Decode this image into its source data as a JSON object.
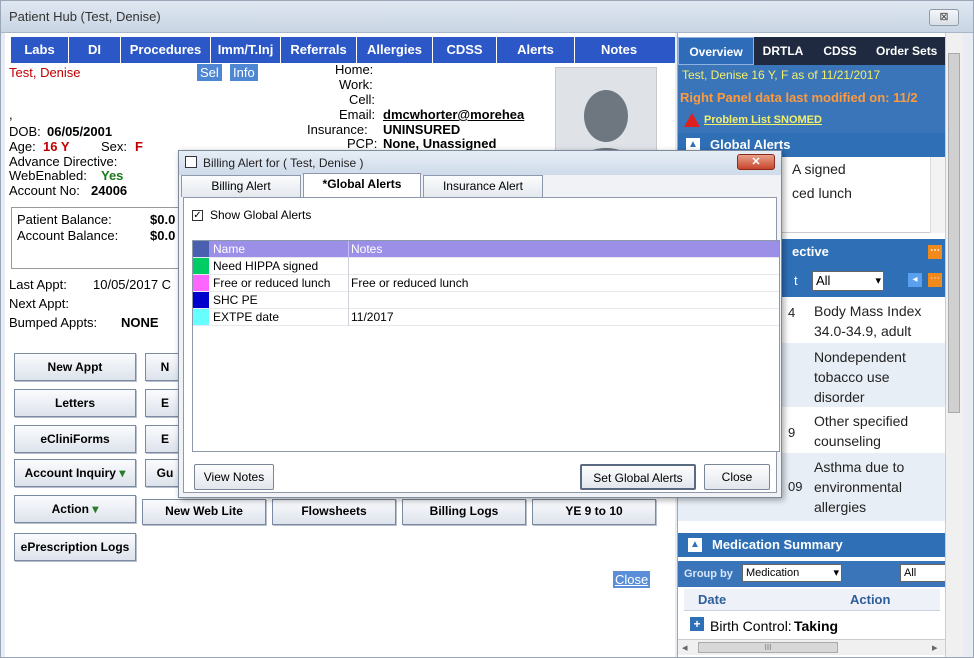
{
  "window": {
    "title": "Patient Hub (Test, Denise)",
    "close_glyph": "⊠"
  },
  "nav": {
    "tabs": [
      "Labs",
      "DI",
      "Procedures",
      "Imm/T.Inj",
      "Referrals",
      "Allergies",
      "CDSS",
      "Alerts",
      "Notes"
    ]
  },
  "patient": {
    "name": "Test, Denise",
    "sel_label": "Sel",
    "info_label": "Info",
    "stray": ", ",
    "dob_label": "DOB:",
    "dob": "06/05/2001",
    "age_label": "Age:",
    "age": "16 Y",
    "sex_label": "Sex:",
    "sex": "F",
    "advance_directive_label": "Advance Directive:",
    "webenabled_label": "WebEnabled:",
    "webenabled": "Yes",
    "account_no_label": "Account No:",
    "account_no": "24006",
    "home_label": "Home:",
    "work_label": "Work:",
    "cell_label": "Cell:",
    "email_label": "Email:",
    "email": "dmcwhorter@morehea",
    "insurance_label": "Insurance:",
    "insurance": "UNINSURED",
    "pcp_label": "PCP:",
    "pcp": "None, Unassigned",
    "patient_balance_label": "Patient Balance:",
    "patient_balance": "$0.0",
    "account_balance_label": "Account Balance:",
    "account_balance": "$0.0",
    "last_appt_label": "Last Appt:",
    "last_appt": "10/05/2017 C",
    "next_appt_label": "Next Appt:",
    "bumped_label": "Bumped Appts:",
    "bumped": "NONE"
  },
  "actions": {
    "new_appt": "New Appt",
    "letters": "Letters",
    "ecliniforms": "eCliniForms",
    "account_inquiry": "Account Inquiry",
    "action": "Action",
    "eprescription_logs": "ePrescription Logs",
    "dropdown_glyph": "▾",
    "partial_n": "N",
    "partial_e1": "E",
    "partial_e2": "E",
    "partial_gu": "Gu",
    "new_web_lite": "New Web Lite",
    "flowsheets": "Flowsheets",
    "billing_logs": "Billing Logs",
    "ye_to_10": "YE 9 to 10",
    "close": "Close"
  },
  "right_panel": {
    "tabs": [
      "Overview",
      "DRTLA",
      "CDSS",
      "Order Sets"
    ],
    "patient_line": "Test, Denise 16 Y, F as of 11/21/2017",
    "modified_line": "Right Panel data last modified on: 11/2",
    "problem_list_link": "Problem List SNOMED",
    "global_alerts_header": "Global Alerts",
    "global_alert_items": [
      "A signed",
      "ced lunch"
    ],
    "directive_header": "ective",
    "filter_value": "All",
    "filter_prefix": "t",
    "problems": [
      {
        "code": "4",
        "text": "Body Mass Index 34.0-34.9, adult"
      },
      {
        "code": "",
        "text": "Nondependent tobacco use disorder"
      },
      {
        "code": "9",
        "text": "Other specified counseling"
      },
      {
        "code": "09",
        "text": "Asthma due to environmental allergies"
      }
    ],
    "medication_header": "Medication Summary",
    "group_by_label": "Group by",
    "group_by_value": "Medication",
    "group_by_value2": "All",
    "med_col_date": "Date",
    "med_col_action": "Action",
    "med_item_name": "Birth Control:",
    "med_item_status": "Taking",
    "scroll_left": "◂",
    "scroll_right": "▸",
    "scroll_grip": "III"
  },
  "dialog": {
    "title": "Billing Alert for ( Test, Denise )",
    "close_glyph": "✕",
    "tabs": [
      "Billing Alert",
      "*Global Alerts",
      "Insurance Alert"
    ],
    "show_label": "Show Global Alerts",
    "columns": [
      "Name",
      "Notes"
    ],
    "rows": [
      {
        "name": "Need HIPPA signed",
        "notes": "",
        "color": "#00cc66"
      },
      {
        "name": "Free or reduced lunch",
        "notes": "Free or reduced lunch",
        "color": "#ff66ff"
      },
      {
        "name": "SHC PE",
        "notes": "",
        "color": "#0000cc"
      },
      {
        "name": "EXTPE date",
        "notes": "11/2017",
        "color": "#66ffff"
      }
    ],
    "view_notes": "View Notes",
    "set_global": "Set Global Alerts",
    "close": "Close"
  },
  "colors": {
    "nav": "#2c57c7",
    "accent_red": "#c00000",
    "highlight_row": "#9b8fe8"
  }
}
